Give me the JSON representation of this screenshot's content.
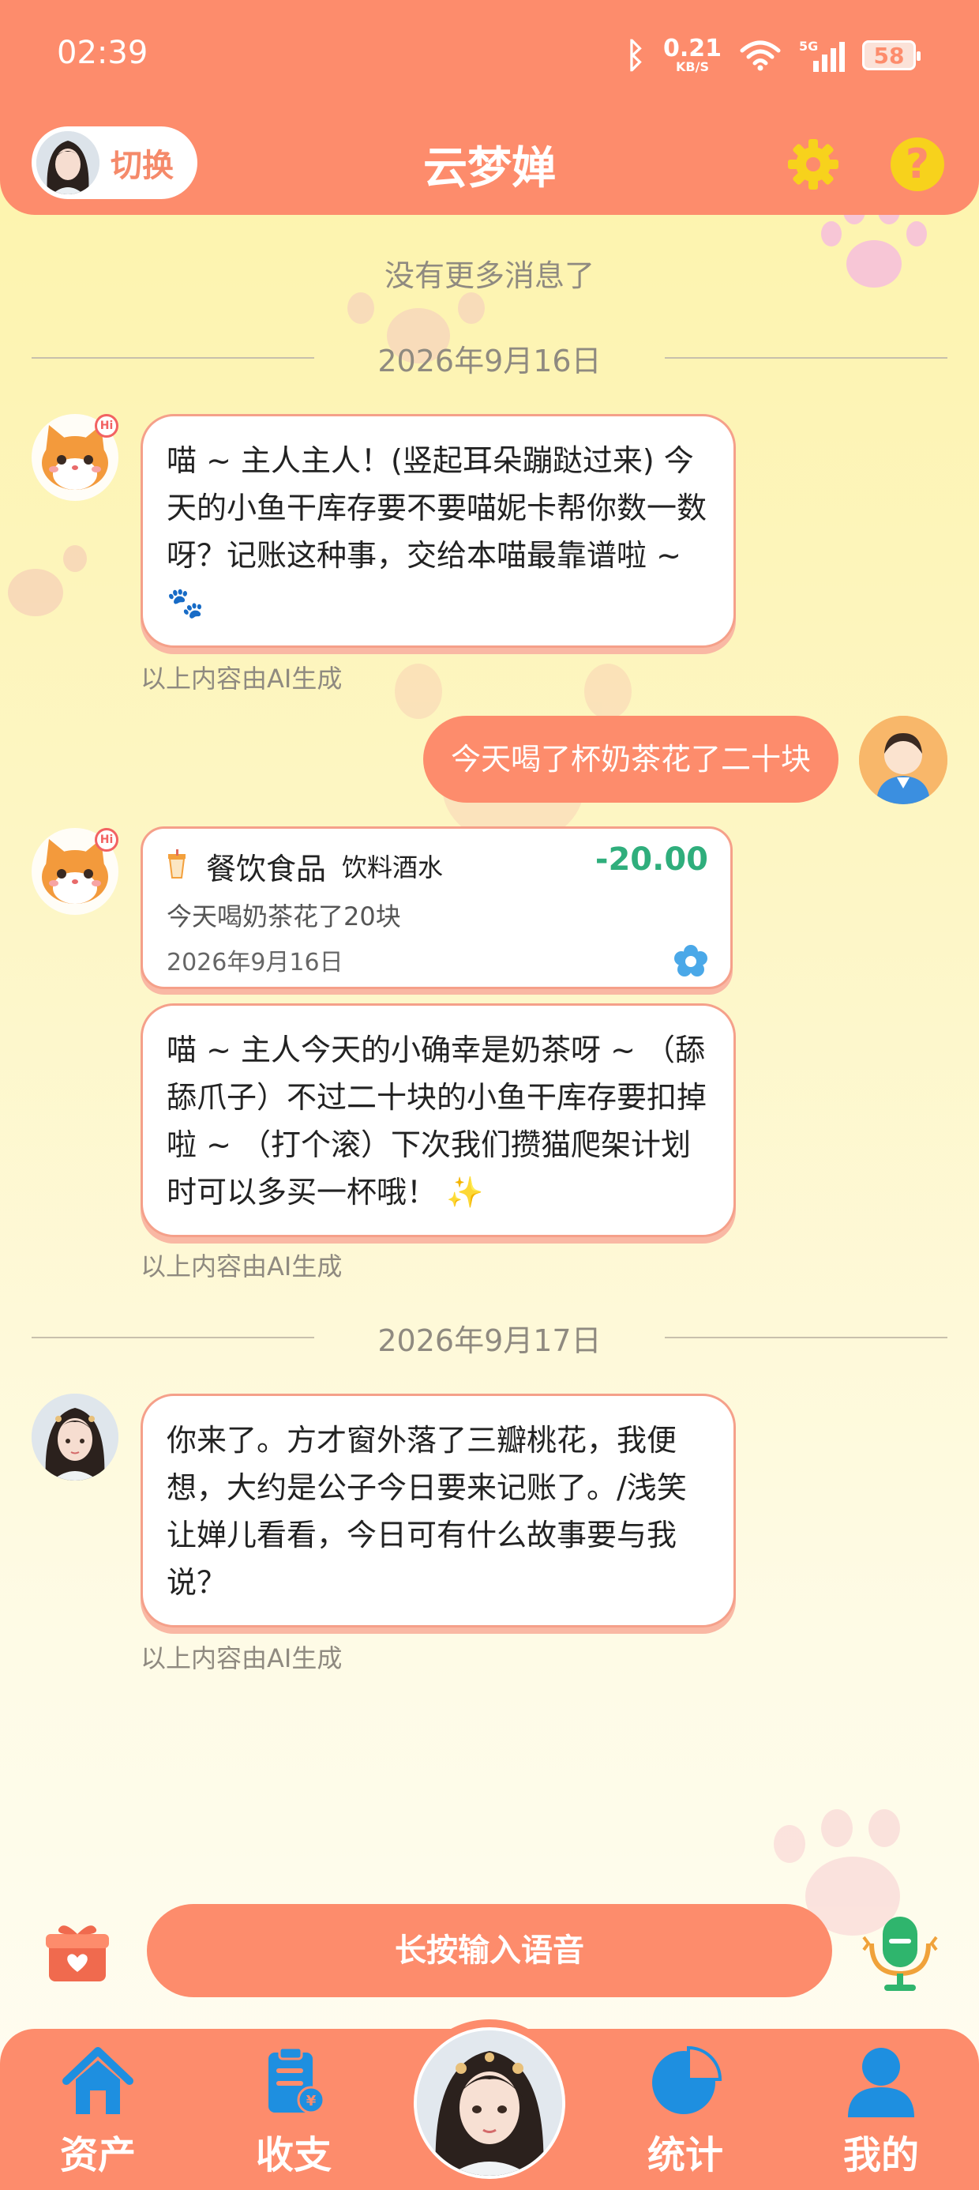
{
  "status_bar": {
    "time": "02:39",
    "net_speed": "0.21",
    "net_unit": "KB/S",
    "signal": "5G",
    "battery": "58"
  },
  "header": {
    "switch_label": "切换",
    "title": "云梦婵"
  },
  "chat": {
    "no_more": "没有更多消息了",
    "date_1": "2026年9月16日",
    "msg_1": "喵 ~ 主人主人！(竖起耳朵蹦跶过来) 今天的小鱼干库存要不要喵妮卡帮你数一数呀？记账这种事，交给本喵最靠谱啦 ~ 🐾",
    "ai_note_1": "以上内容由AI生成",
    "user_msg": "今天喝了杯奶茶花了二十块",
    "record": {
      "category": "餐饮食品",
      "subcategory": "饮料酒水",
      "amount": "-20.00",
      "description": "今天喝奶茶花了20块",
      "date": "2026年9月16日"
    },
    "msg_2": "喵 ~ 主人今天的小确幸是奶茶呀 ~ （舔舔爪子）不过二十块的小鱼干库存要扣掉啦 ~ （打个滚）下次我们攒猫爬架计划时可以多买一杯哦！ ✨",
    "ai_note_2": "以上内容由AI生成",
    "date_2": "2026年9月17日",
    "msg_3": "你来了。方才窗外落了三瓣桃花，我便想，大约是公子今日要来记账了。/浅笑 让婵儿看看，今日可有什么故事要与我说？",
    "ai_note_3": "以上内容由AI生成"
  },
  "input": {
    "voice_label": "长按输入语音"
  },
  "tabs": [
    {
      "label": "资产"
    },
    {
      "label": "收支"
    },
    {
      "label": "统计"
    },
    {
      "label": "我的"
    }
  ],
  "colors": {
    "primary": "#fd8c6c",
    "amount_green": "#2fae7c",
    "icon_yellow": "#f7d21c",
    "tab_icon_blue": "#1e8fe0"
  }
}
